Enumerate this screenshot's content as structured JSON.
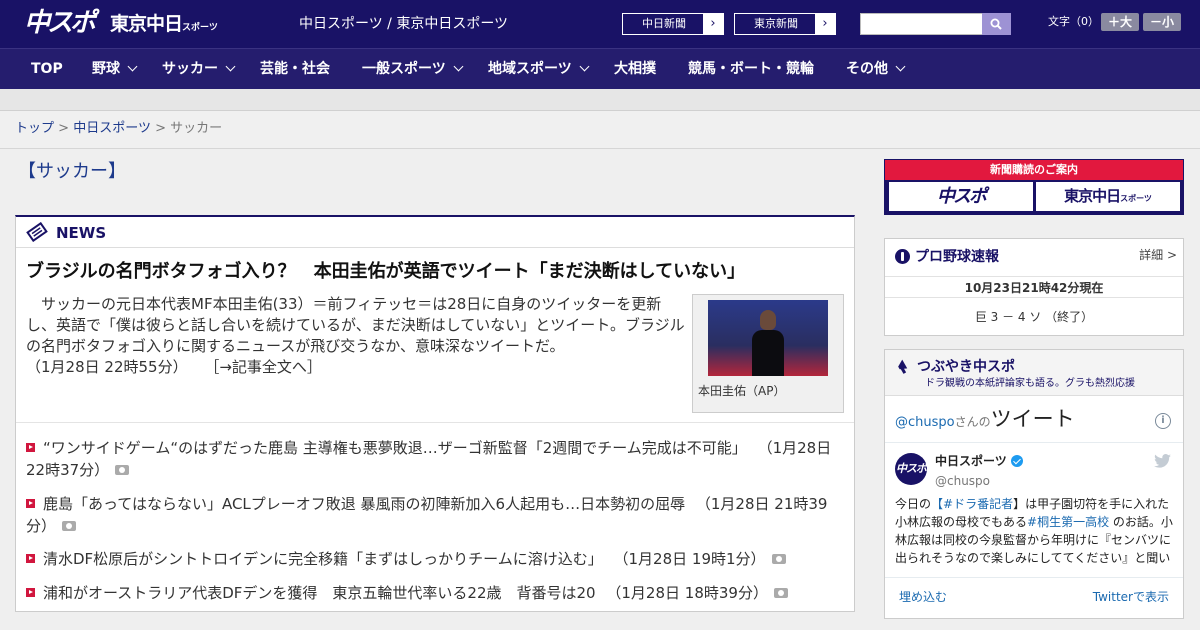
{
  "header": {
    "logo_chuspo": "中スポ",
    "logo_tokyo": "東京中日",
    "logo_tokyo_suffix": "スポーツ",
    "site_links": "中日スポーツ / 東京中日スポーツ",
    "ext_links": [
      {
        "label": "中日新聞",
        "arrow": "›"
      },
      {
        "label": "東京新聞",
        "arrow": "›"
      }
    ],
    "search_placeholder": "",
    "font_size_label": "文字（0）",
    "font_bigger": "＋大",
    "font_smaller": "－小"
  },
  "nav": {
    "items": [
      {
        "label": "TOP"
      },
      {
        "label": "野球"
      },
      {
        "label": "サッカー"
      },
      {
        "label": "芸能・社会"
      },
      {
        "label": "一般スポーツ"
      },
      {
        "label": "地域スポーツ"
      },
      {
        "label": "大相撲"
      },
      {
        "label": "競馬・ボート・競輪"
      },
      {
        "label": "その他"
      }
    ]
  },
  "breadcrumb": {
    "home": "トップ",
    "sep": ">",
    "section": "中日スポーツ",
    "current": "サッカー"
  },
  "page_title": "【サッカー】",
  "news": {
    "label": "NEWS",
    "headline": "ブラジルの名門ボタフォゴ入り？　本田圭佑が英語でツイート「まだ決断はしていない」",
    "summary": "　サッカーの元日本代表MF本田圭佑(33）＝前フィテッセ＝は28日に自身のツイッターを更新し、英語で「僕は彼らと話し合いを続けているが、まだ決断はしていない」とツイート。ブラジルの名門ボタフォゴ入りに関するニュースが飛び交うなか、意味深なツイートだ。",
    "summary_time": "（1月28日 22時55分）",
    "read_more": "［→記事全文へ］",
    "photo_caption": "本田圭佑（AP）",
    "items": [
      {
        "text": "“ワンサイドゲーム“のはずだった鹿島 主導権も悪夢敗退…ザーゴ新監督「2週間でチーム完成は不可能」",
        "time": "（1月28日 22時37分）"
      },
      {
        "text": "鹿島「あってはならない」ACLプレーオフ敗退 暴風雨の初陣新加入6人起用も…日本勢初の屈辱",
        "time": "（1月28日 21時39分）"
      },
      {
        "text": "清水DF松原后がシントトロイデンに完全移籍「まずはしっかりチームに溶け込む」",
        "time": "（1月28日 19時1分）"
      },
      {
        "text": "浦和がオーストラリア代表DFデンを獲得　東京五輪世代率いる22歳　背番号は20",
        "time": "（1月28日 18時39分）"
      }
    ]
  },
  "subscription": {
    "label": "新聞購読のご案内",
    "logo1": "中スポ",
    "logo2": "東京中日",
    "logo2_suffix": "スポーツ"
  },
  "baseball": {
    "title": "プロ野球速報",
    "more": "詳細 >",
    "time": "10月23日21時42分現在",
    "score": "巨 3 － 4 ソ （終了）"
  },
  "tweets": {
    "title": "つぶやき中スポ",
    "subtitle": "ドラ観戦の本紙評論家も語る。グラも熱烈応援",
    "handle": "@chuspo",
    "handle_suffix": "さんの",
    "widget_title": "ツイート",
    "info": "i",
    "avatar": "中スポ",
    "account_name": "中日スポーツ",
    "account_handle": "@chuspo",
    "text_1": "今日の",
    "tag_1": "【#ドラ番記者",
    "text_2": "】は甲子園切符を手に入れた小林広報の母校でもある",
    "tag_2": "#桐生第一高校",
    "text_3": " のお話。小林広報は同校の今泉監督から年明けに『センバツに出られそうなので楽しみにしててください』と聞いていたそうです。",
    "embed": "埋め込む",
    "view_on": "Twitterで表示"
  },
  "colors": {
    "brand_navy": "#191266",
    "accent_red": "#d1163e",
    "link_blue": "#1d3a8c"
  }
}
